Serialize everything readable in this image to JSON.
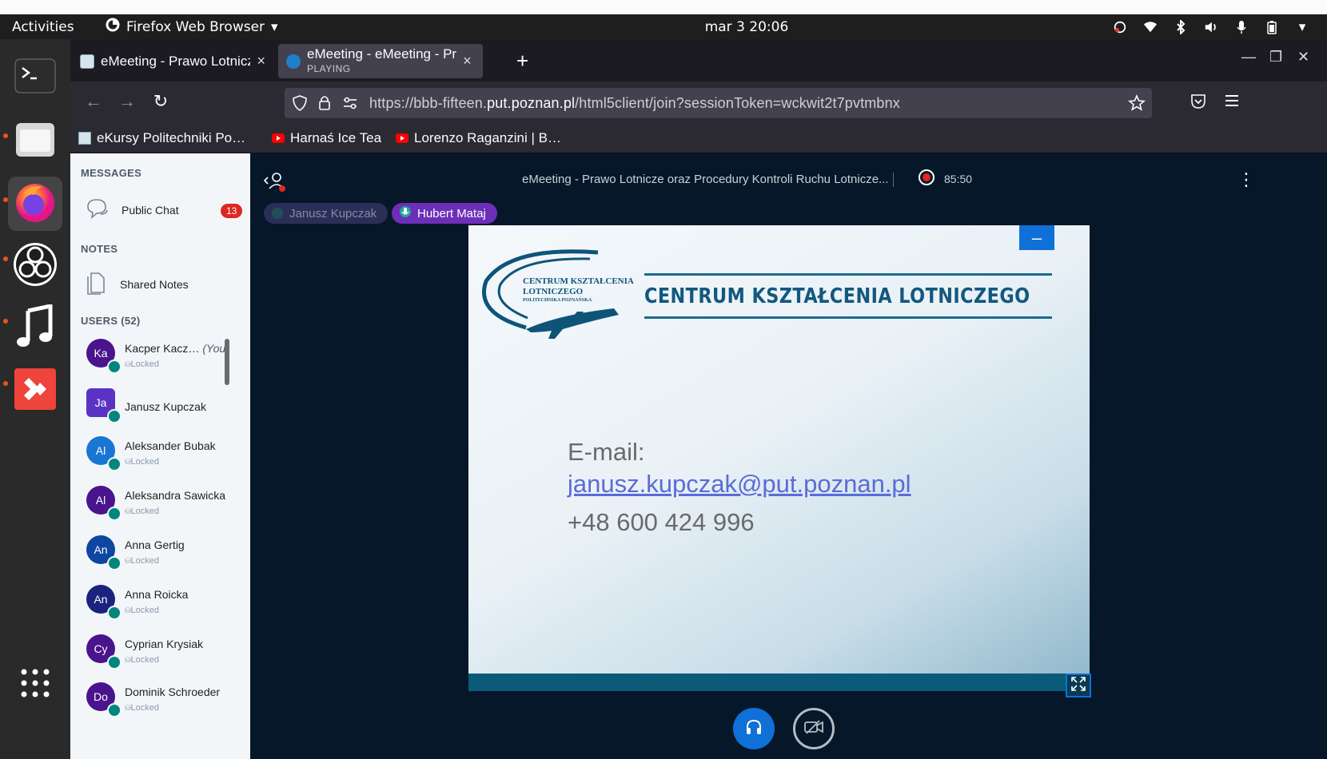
{
  "topbar": {
    "activities": "Activities",
    "app_name": "Firefox Web Browser",
    "clock": "mar 3  20:06"
  },
  "browser": {
    "tabs": [
      {
        "title": "eMeeting - Prawo Lotnicz",
        "close": "×"
      },
      {
        "title": "eMeeting - eMeeting - Pr",
        "subtitle": "PLAYING",
        "close": "×"
      }
    ],
    "new_tab": "+",
    "url_prefix": "https://bbb-fifteen.",
    "url_domain": "put.poznan.pl",
    "url_path": "/html5client/join?sessionToken=wckwit2t7pvtmbnx",
    "bookmarks": [
      "eKursy Politechniki Po…",
      "Harnaś Ice Tea",
      "Lorenzo Raganzini | B…"
    ]
  },
  "sidebar": {
    "messages_header": "MESSAGES",
    "public_chat": "Public Chat",
    "chat_badge": "13",
    "notes_header": "NOTES",
    "shared_notes": "Shared Notes",
    "users_header": "USERS (52)",
    "users": [
      {
        "initials": "Ka",
        "name": "Kacper Kacz…",
        "you": "(You)",
        "status": "Locked",
        "color": "#4a148c"
      },
      {
        "initials": "Ja",
        "name": "Janusz Kupczak",
        "status": "",
        "color": "#5b33c4"
      },
      {
        "initials": "Al",
        "name": "Aleksander Bubak",
        "status": "Locked",
        "color": "#1976d2"
      },
      {
        "initials": "Al",
        "name": "Aleksandra Sawicka",
        "status": "Locked",
        "color": "#4a148c"
      },
      {
        "initials": "An",
        "name": "Anna Gertig",
        "status": "Locked",
        "color": "#0d47a1"
      },
      {
        "initials": "An",
        "name": "Anna Roicka",
        "status": "Locked",
        "color": "#1a237e"
      },
      {
        "initials": "Cy",
        "name": "Cyprian Krysiak",
        "status": "Locked",
        "color": "#4a148c"
      },
      {
        "initials": "Do",
        "name": "Dominik Schroeder",
        "status": "Locked",
        "color": "#4a148c"
      }
    ]
  },
  "meeting": {
    "title": "eMeeting - Prawo Lotnicze oraz Procedury Kontroli Ruchu Lotnicze...",
    "recording_time": "85:50",
    "talkers": [
      "Janusz Kupczak",
      "Hubert Mataj"
    ]
  },
  "slide": {
    "logo_line1": "CENTRUM KSZTAŁCENIA",
    "logo_line2": "LOTNICZEGO",
    "logo_line3": "POLITECHNIKA POZNAŃSKA",
    "heading": "CENTRUM KSZTAŁCENIA LOTNICZEGO",
    "email_label": "E-mail:",
    "email": "janusz.kupczak@put.poznan.pl",
    "phone": "+48 600 424 996"
  },
  "colors": {
    "brand": "#0f70d7",
    "dark_bg": "#06172a",
    "badge": "#df2721"
  }
}
